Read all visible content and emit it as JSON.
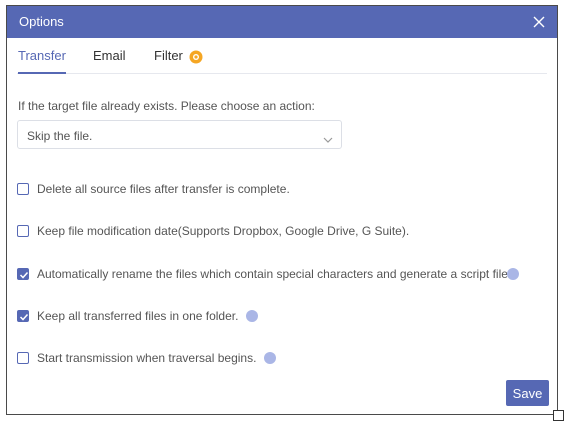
{
  "dialog": {
    "title": "Options"
  },
  "tabs": [
    {
      "label": "Transfer",
      "active": true
    },
    {
      "label": "Email",
      "active": false
    },
    {
      "label": "Filter",
      "active": false,
      "badge_color": "#f5a623"
    }
  ],
  "transfer": {
    "prompt": "If the target file already exists. Please choose an action:",
    "action_select": {
      "value": "Skip the file."
    },
    "options": [
      {
        "label": "Delete all source files after transfer is complete.",
        "checked": false,
        "help": false
      },
      {
        "label": "Keep file modification date(Supports Dropbox, Google Drive, G Suite).",
        "checked": false,
        "help": false
      },
      {
        "label": "Automatically rename the files which contain special characters and generate a script file.",
        "checked": true,
        "help": true
      },
      {
        "label": "Keep all transferred files in one folder.",
        "checked": true,
        "help": true
      },
      {
        "label": "Start transmission when traversal begins.",
        "checked": false,
        "help": true
      }
    ]
  },
  "footer": {
    "save_label": "Save"
  },
  "colors": {
    "accent": "#5668b4",
    "help_icon": "#aab6e6",
    "badge": "#f5a623"
  }
}
